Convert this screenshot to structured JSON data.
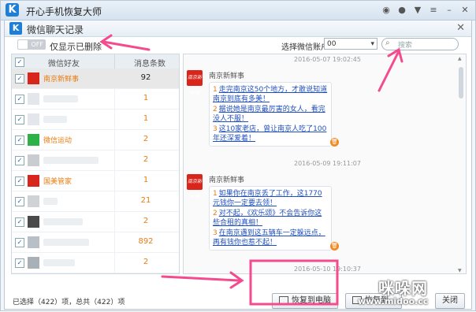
{
  "app": {
    "title": "开心手机恢复大师",
    "logo": "K"
  },
  "dialog": {
    "title": "微信聊天记录",
    "toggle_state": "OFF",
    "toggle_label": "仅显示已删除",
    "account_label": "选择微信账户",
    "account_value": "00",
    "search_placeholder": "搜索"
  },
  "table": {
    "col_friend": "微信好友",
    "col_count": "消息条数",
    "rows": [
      {
        "name": "南京新鲜事",
        "count": "92",
        "checked": true,
        "selected": true
      },
      {
        "name": "",
        "count": "1",
        "checked": true
      },
      {
        "name": "",
        "count": "1",
        "checked": true
      },
      {
        "name": "微信运动",
        "count": "2",
        "checked": true
      },
      {
        "name": "",
        "count": "2",
        "checked": true
      },
      {
        "name": "国美管家",
        "count": "1",
        "checked": true
      },
      {
        "name": "",
        "count": "21",
        "checked": true
      },
      {
        "name": "",
        "count": "2",
        "checked": true
      },
      {
        "name": "",
        "count": "892",
        "checked": true
      },
      {
        "name": "",
        "count": "2",
        "checked": true
      }
    ]
  },
  "chat": {
    "messages": [
      {
        "timestamp": "2016-05-07 19:02:45",
        "sender": "南京新鲜事",
        "avatar_text": "南京新鲜事",
        "items": [
          {
            "n": "1",
            "text": "走完南京这50个地方，才敢说知道南京到底有多美！"
          },
          {
            "n": "2",
            "text": "据说她是南京最厉害的女人，看完没人不服！"
          },
          {
            "n": "3",
            "text": "这10家老店，曾让南京人吃了100年还深爱着！"
          }
        ]
      },
      {
        "timestamp": "2016-05-09 19:11:07",
        "sender": "南京新鲜事",
        "avatar_text": "南京新鲜事",
        "items": [
          {
            "n": "1",
            "text": "如果你在南京丢了工作，这1770元钱你一定要去领！"
          },
          {
            "n": "2",
            "text": "对不起，《欢乐颂》不会告诉你这些合租的真相！"
          },
          {
            "n": "3",
            "text": "在南京遇到这五辆车一定躲远点，再有钱你也惹不起！"
          }
        ]
      }
    ],
    "partial_timestamp": "2016-05-10 19:10:37"
  },
  "footer": {
    "status": "已选择（422）项，总共（422）项",
    "btn_restore_pc": "恢复到电脑",
    "btn_restore_phone": "恢复到",
    "btn_close": "关闭"
  },
  "watermark": {
    "line1": "咪哚网",
    "line2": "www.midoo.cc"
  },
  "colors": {
    "accent": "#1f7fd6",
    "highlight": "#f44b8e",
    "orange": "#e87c12"
  }
}
